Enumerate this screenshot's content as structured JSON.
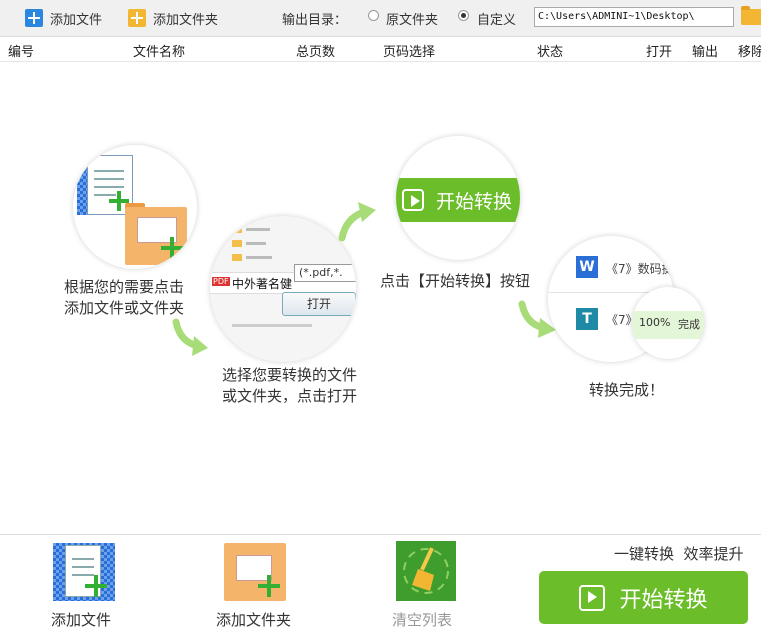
{
  "toolbar": {
    "add_file": "添加文件",
    "add_folder": "添加文件夹",
    "output_dir_label": "输出目录：",
    "radio_original": "原文件夹",
    "radio_custom": "自定义",
    "output_path": "C:\\Users\\ADMINI~1\\Desktop\\"
  },
  "columns": [
    "编号",
    "文件名称",
    "总页数",
    "页码选择",
    "状态",
    "打开",
    "输出",
    "移除"
  ],
  "steps": {
    "step1_caption_line1": "根据您的需要点击",
    "step1_caption_line2": "添加文件或文件夹",
    "step2_filename": "中外著名健",
    "step2_filter": "(*.pdf,*.",
    "step2_open": "打开",
    "step2_caption_line1": "选择您要转换的文件",
    "step2_caption_line2": "或文件夹，点击打开",
    "step3_button": "开始转换",
    "step3_caption": "点击【开始转换】按钮",
    "step4_item1": "《7》数码摄",
    "step4_item2": "《7》",
    "step4_progress": "100%",
    "step4_done": "完成",
    "step4_caption": "转换完成！"
  },
  "bottom": {
    "add_file": "添加文件",
    "add_folder": "添加文件夹",
    "clear_list": "清空列表",
    "slogan": "一键转换  效率提升",
    "start_button": "开始转换"
  },
  "colors": {
    "accent_green": "#6bbd2a",
    "accent_blue": "#2b86e0",
    "folder_orange": "#f4b56a"
  }
}
